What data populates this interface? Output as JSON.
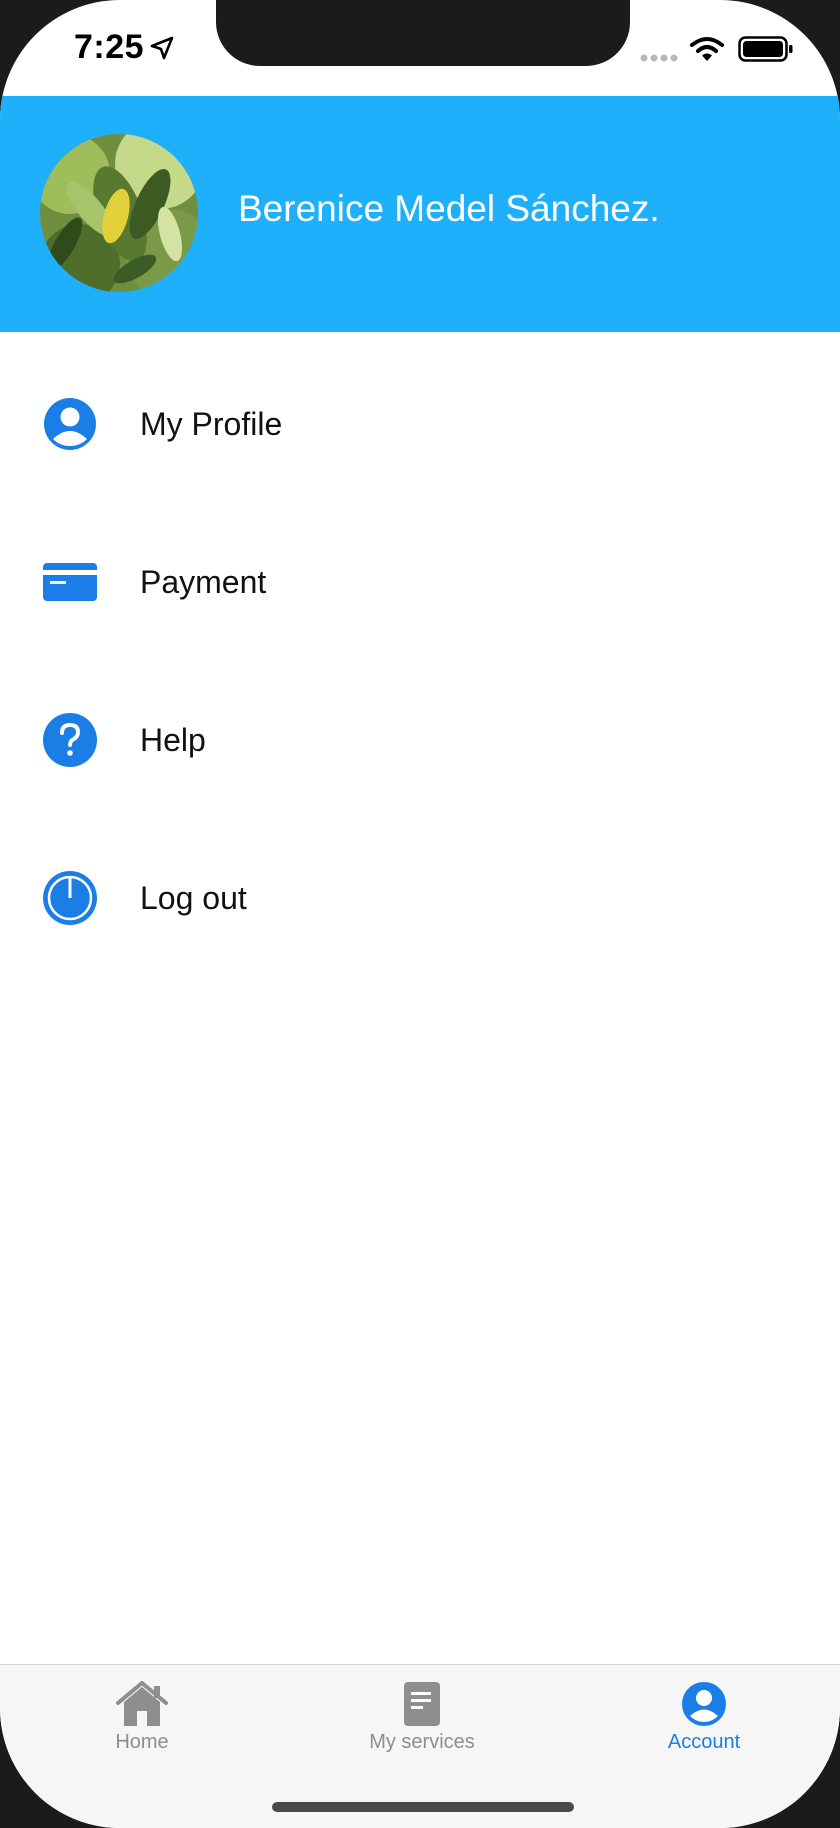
{
  "status_bar": {
    "time": "7:25",
    "icons": [
      "location-arrow-icon",
      "signal-icon",
      "wifi-icon",
      "battery-icon"
    ]
  },
  "header": {
    "user_name": "Berenice Medel Sánchez.",
    "background_color": "#1fb0fc"
  },
  "menu": {
    "items": [
      {
        "label": "My Profile",
        "icon": "profile-icon"
      },
      {
        "label": "Payment",
        "icon": "credit-card-icon"
      },
      {
        "label": "Help",
        "icon": "help-icon"
      },
      {
        "label": "Log out",
        "icon": "power-icon"
      }
    ],
    "icon_color": "#1a7ee6"
  },
  "tab_bar": {
    "tabs": [
      {
        "label": "Home",
        "icon": "home-icon",
        "active": false
      },
      {
        "label": "My services",
        "icon": "document-icon",
        "active": false
      },
      {
        "label": "Account",
        "icon": "account-icon",
        "active": true
      }
    ],
    "active_color": "#1a7ee6",
    "inactive_color": "#8e8e8e"
  }
}
